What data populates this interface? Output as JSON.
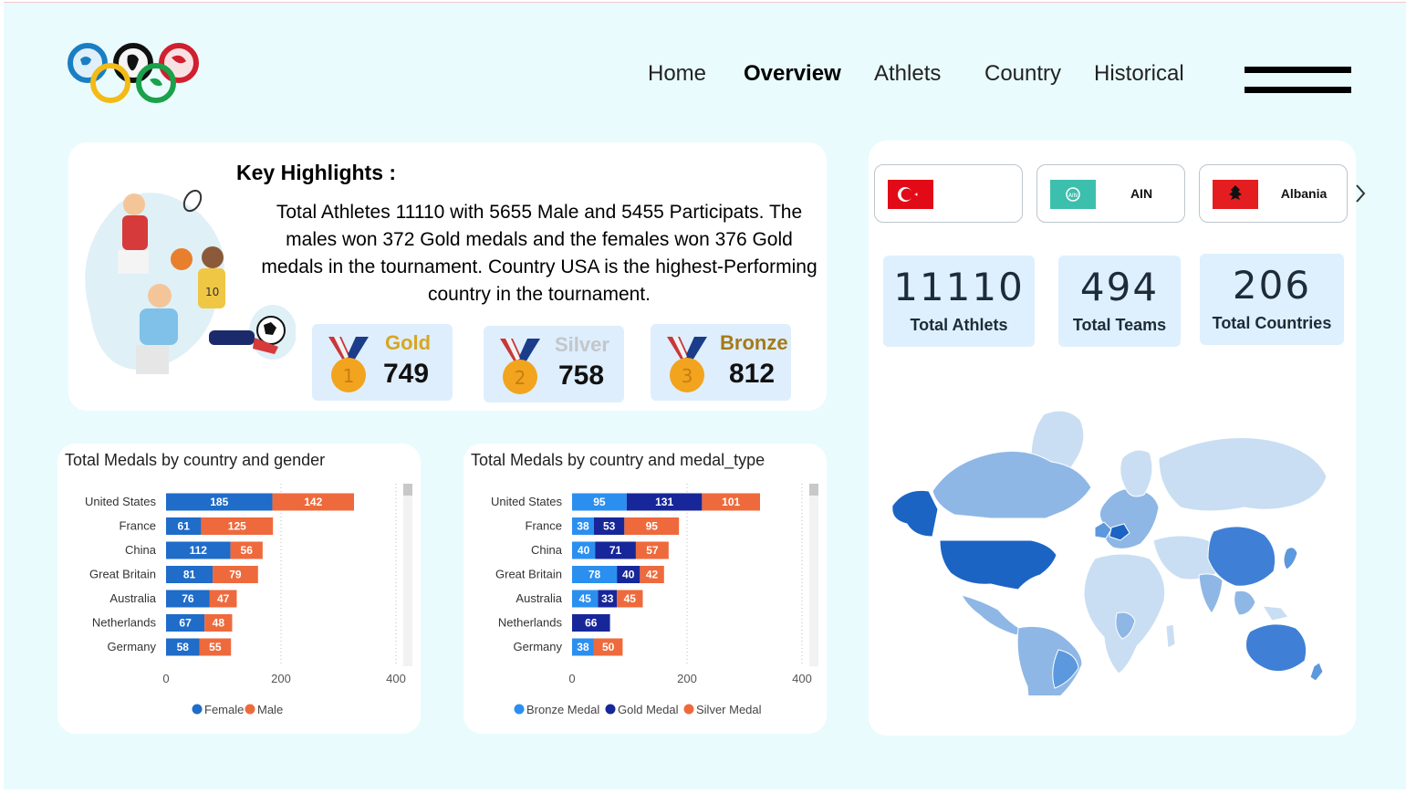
{
  "nav": {
    "items": [
      {
        "label": "Home",
        "active": false
      },
      {
        "label": "Overview",
        "active": true
      },
      {
        "label": "Athlets",
        "active": false
      },
      {
        "label": "Country",
        "active": false
      },
      {
        "label": "Historical",
        "active": false
      }
    ]
  },
  "highlights": {
    "title": "Key Highlights :",
    "text": "Total Athletes 11110 with 5655 Male and 5455 Participats. The males won 372 Gold medals and the females won 376 Gold medals in the tournament. Country USA is the highest-Performing country in the tournament."
  },
  "medals": [
    {
      "label": "Gold",
      "value": "749",
      "color": "#d8a623"
    },
    {
      "label": "Silver",
      "value": "758",
      "color": "#c3c6cc"
    },
    {
      "label": "Bronze",
      "value": "812",
      "color": "#a57a19"
    }
  ],
  "countries": [
    {
      "name": "",
      "flag": "turkey-flag"
    },
    {
      "name": "AIN",
      "flag": "ain-flag"
    },
    {
      "name": "Albania",
      "flag": "albania-flag"
    }
  ],
  "kpis": [
    {
      "value": "11110",
      "label": "Total Athlets"
    },
    {
      "value": "494",
      "label": "Total Teams"
    },
    {
      "value": "206",
      "label": "Total Countries"
    }
  ],
  "colors": {
    "female": "#1f6cc9",
    "male": "#ee6a3c",
    "bronze_medal": "#2b8ff0",
    "gold_medal": "#17279a",
    "silver_medal": "#ee6a3c"
  },
  "chart_data": [
    {
      "type": "bar",
      "orientation": "horizontal",
      "stacked": true,
      "title": "Total Medals by country and gender",
      "categories": [
        "United States",
        "France",
        "China",
        "Great Britain",
        "Australia",
        "Netherlands",
        "Germany"
      ],
      "series": [
        {
          "name": "Female",
          "values": [
            185,
            61,
            112,
            81,
            76,
            67,
            58
          ],
          "color": "#1f6cc9"
        },
        {
          "name": "Male",
          "values": [
            142,
            125,
            56,
            79,
            47,
            48,
            55
          ],
          "color": "#ee6a3c"
        }
      ],
      "xticks": [
        "0",
        "200",
        "400"
      ],
      "xlim": [
        0,
        400
      ],
      "legend": "bottom"
    },
    {
      "type": "bar",
      "orientation": "horizontal",
      "stacked": true,
      "title": "Total Medals by country and medal_type",
      "categories": [
        "United States",
        "France",
        "China",
        "Great Britain",
        "Australia",
        "Netherlands",
        "Germany"
      ],
      "series": [
        {
          "name": "Bronze Medal",
          "values": [
            95,
            38,
            40,
            78,
            45,
            0,
            38
          ],
          "color": "#2b8ff0"
        },
        {
          "name": "Gold Medal",
          "values": [
            131,
            53,
            71,
            40,
            33,
            66,
            0
          ],
          "color": "#17279a"
        },
        {
          "name": "Silver Medal",
          "values": [
            101,
            95,
            57,
            42,
            45,
            0,
            50
          ],
          "color": "#ee6a3c"
        }
      ],
      "xticks": [
        "0",
        "200",
        "400"
      ],
      "xlim": [
        0,
        400
      ],
      "legend": "bottom"
    }
  ]
}
